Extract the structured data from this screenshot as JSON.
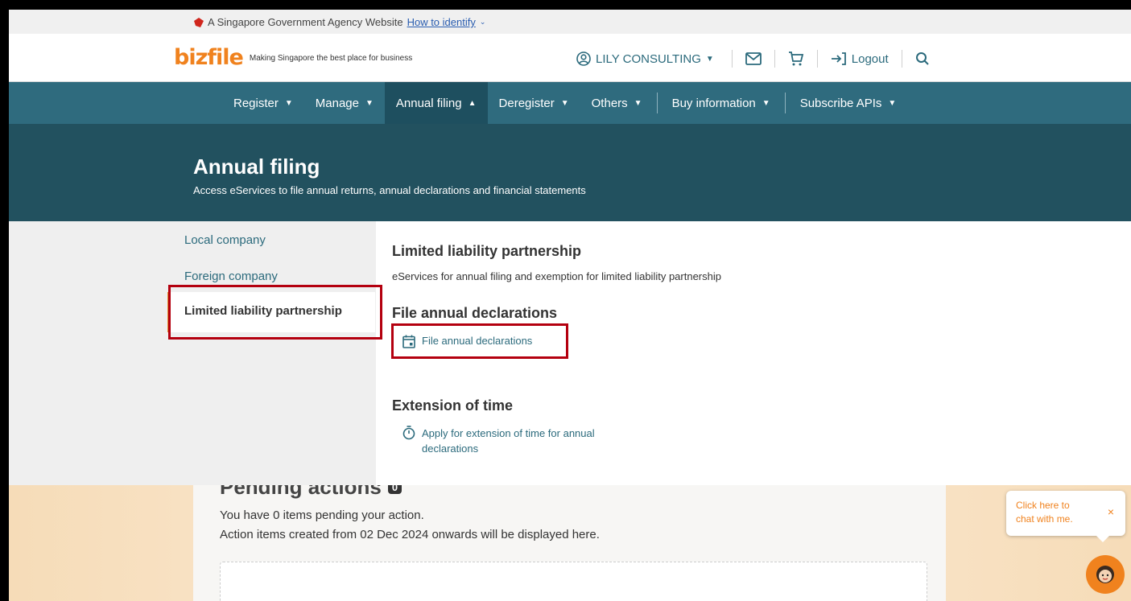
{
  "gov_bar": {
    "text": "A Singapore Government Agency Website",
    "link": "How to identify"
  },
  "header": {
    "logo": "bizfile",
    "tagline": "Making Singapore the best place for business",
    "account": "LILY CONSULTING",
    "logout": "Logout"
  },
  "nav": {
    "items": [
      {
        "label": "Register"
      },
      {
        "label": "Manage"
      },
      {
        "label": "Annual filing"
      },
      {
        "label": "Deregister"
      },
      {
        "label": "Others"
      },
      {
        "label": "Buy information"
      },
      {
        "label": "Subscribe APIs"
      }
    ]
  },
  "hero": {
    "title": "Annual filing",
    "subtitle": "Access eServices to file annual returns, annual declarations and financial statements"
  },
  "sidebar": {
    "items": [
      {
        "label": "Local company"
      },
      {
        "label": "Foreign company"
      },
      {
        "label": "Limited liability partnership"
      }
    ]
  },
  "content": {
    "title": "Limited liability partnership",
    "description": "eServices for annual filing and exemption for limited liability partnership",
    "section1_title": "File annual declarations",
    "section1_link": "File annual declarations",
    "section2_title": "Extension of time",
    "section2_link_line1": "Apply for extension of time for annual",
    "section2_link_line2": "declarations"
  },
  "pending": {
    "title": "Pending actions",
    "count": "0",
    "line1": "You have 0 items pending your action.",
    "line2": "Action items created from 02 Dec 2024 onwards will be displayed here."
  },
  "chat": {
    "text_line1": "Click here to",
    "text_line2": "chat with me.",
    "close": "×"
  },
  "colors": {
    "nav_bg": "#2f6b7e",
    "hero_bg": "#22515f",
    "accent": "#f0821e",
    "link": "#2b6a7c",
    "highlight": "#b4000f"
  }
}
